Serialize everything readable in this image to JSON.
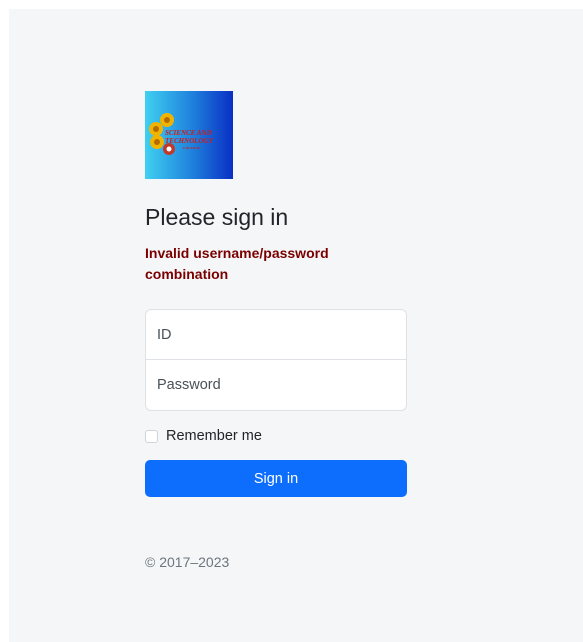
{
  "logo": {
    "line1": "SCIENCE AND",
    "line2": "TECHNOLOGY",
    "line3": "COLLEGE",
    "colors": {
      "gradient_start": "#3fd0f0",
      "gradient_end": "#0a2fc4",
      "emblem": "#f0b400",
      "text": "#d11a1a"
    }
  },
  "form": {
    "heading": "Please sign in",
    "error_message": "Invalid username/password combination",
    "id_placeholder": "ID",
    "password_placeholder": "Password",
    "remember_label": "Remember me",
    "remember_checked": false,
    "submit_label": "Sign in"
  },
  "footer": {
    "copyright": "© 2017–2023"
  },
  "colors": {
    "primary": "#0d6efd",
    "error": "#7a0000",
    "background": "#f5f6f8"
  }
}
